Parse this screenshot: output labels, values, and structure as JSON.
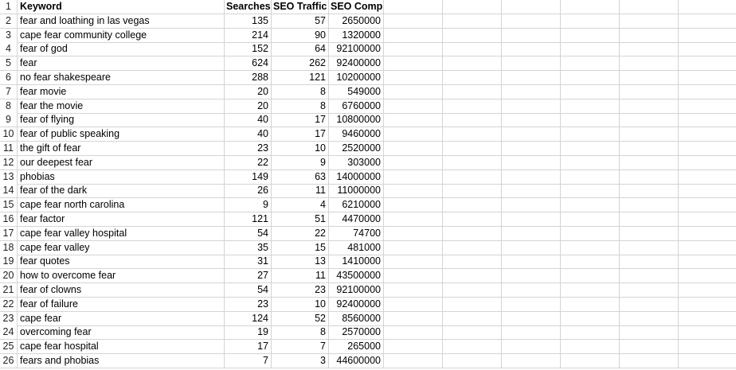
{
  "headers": {
    "row_number": "1",
    "keyword": "Keyword",
    "searches": "Searches",
    "seo_traffic": "SEO Traffic",
    "seo_comp": "SEO Comp"
  },
  "rows": [
    {
      "n": "2",
      "keyword": "fear and loathing in las vegas",
      "searches": "135",
      "traffic": "57",
      "comp": "2650000"
    },
    {
      "n": "3",
      "keyword": "cape fear community college",
      "searches": "214",
      "traffic": "90",
      "comp": "1320000"
    },
    {
      "n": "4",
      "keyword": "fear of god",
      "searches": "152",
      "traffic": "64",
      "comp": "92100000"
    },
    {
      "n": "5",
      "keyword": "fear",
      "searches": "624",
      "traffic": "262",
      "comp": "92400000"
    },
    {
      "n": "6",
      "keyword": "no fear shakespeare",
      "searches": "288",
      "traffic": "121",
      "comp": "10200000"
    },
    {
      "n": "7",
      "keyword": "fear movie",
      "searches": "20",
      "traffic": "8",
      "comp": "549000"
    },
    {
      "n": "8",
      "keyword": "fear the movie",
      "searches": "20",
      "traffic": "8",
      "comp": "6760000"
    },
    {
      "n": "9",
      "keyword": "fear of flying",
      "searches": "40",
      "traffic": "17",
      "comp": "10800000"
    },
    {
      "n": "10",
      "keyword": "fear of public speaking",
      "searches": "40",
      "traffic": "17",
      "comp": "9460000"
    },
    {
      "n": "11",
      "keyword": "the gift of fear",
      "searches": "23",
      "traffic": "10",
      "comp": "2520000"
    },
    {
      "n": "12",
      "keyword": "our deepest fear",
      "searches": "22",
      "traffic": "9",
      "comp": "303000"
    },
    {
      "n": "13",
      "keyword": "phobias",
      "searches": "149",
      "traffic": "63",
      "comp": "14000000"
    },
    {
      "n": "14",
      "keyword": "fear of the dark",
      "searches": "26",
      "traffic": "11",
      "comp": "11000000"
    },
    {
      "n": "15",
      "keyword": "cape fear north carolina",
      "searches": "9",
      "traffic": "4",
      "comp": "6210000"
    },
    {
      "n": "16",
      "keyword": "fear factor",
      "searches": "121",
      "traffic": "51",
      "comp": "4470000"
    },
    {
      "n": "17",
      "keyword": "cape fear valley hospital",
      "searches": "54",
      "traffic": "22",
      "comp": "74700"
    },
    {
      "n": "18",
      "keyword": "cape fear valley",
      "searches": "35",
      "traffic": "15",
      "comp": "481000"
    },
    {
      "n": "19",
      "keyword": "fear quotes",
      "searches": "31",
      "traffic": "13",
      "comp": "1410000"
    },
    {
      "n": "20",
      "keyword": "how to overcome fear",
      "searches": "27",
      "traffic": "11",
      "comp": "43500000"
    },
    {
      "n": "21",
      "keyword": "fear of clowns",
      "searches": "54",
      "traffic": "23",
      "comp": "92100000"
    },
    {
      "n": "22",
      "keyword": "fear of failure",
      "searches": "23",
      "traffic": "10",
      "comp": "92400000"
    },
    {
      "n": "23",
      "keyword": "cape fear",
      "searches": "124",
      "traffic": "52",
      "comp": "8560000"
    },
    {
      "n": "24",
      "keyword": "overcoming fear",
      "searches": "19",
      "traffic": "8",
      "comp": "2570000"
    },
    {
      "n": "25",
      "keyword": "cape fear hospital",
      "searches": "17",
      "traffic": "7",
      "comp": "265000"
    },
    {
      "n": "26",
      "keyword": "fears and phobias",
      "searches": "7",
      "traffic": "3",
      "comp": "44600000"
    }
  ]
}
